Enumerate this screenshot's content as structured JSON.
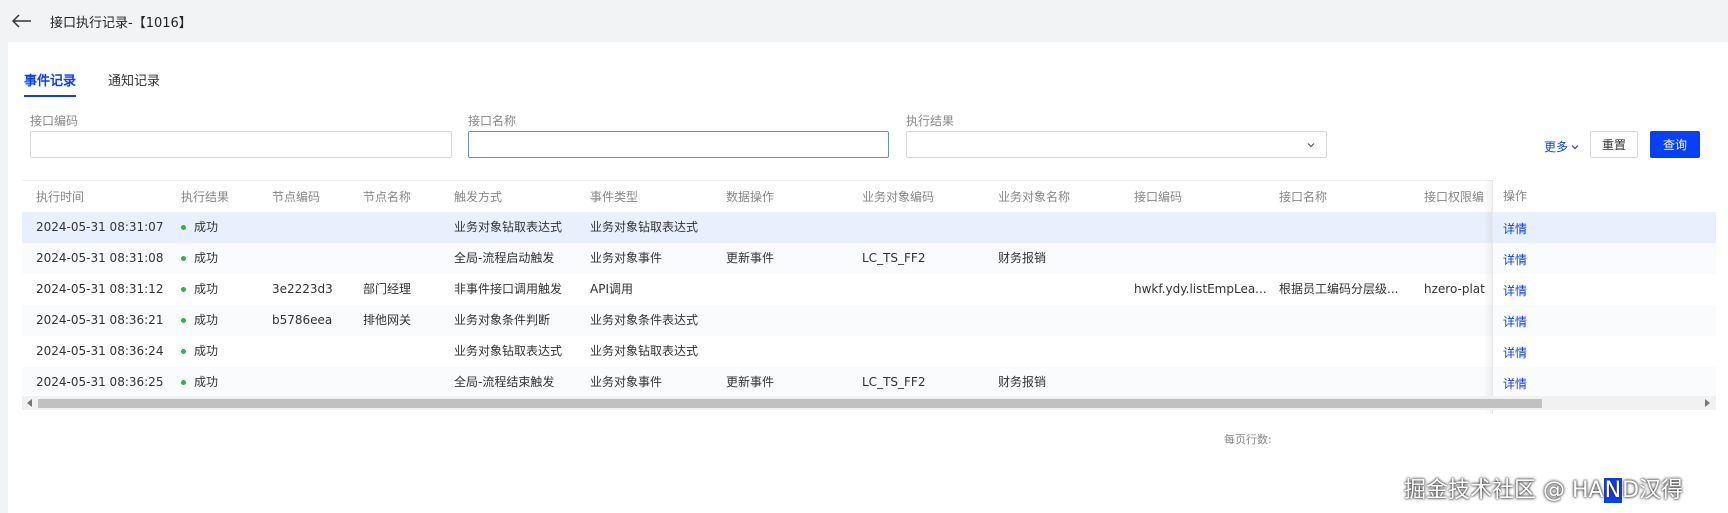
{
  "header": {
    "title": "接口执行记录-【1016】"
  },
  "tabs": [
    {
      "label": "事件记录",
      "active": true
    },
    {
      "label": "通知记录",
      "active": false
    }
  ],
  "filters": {
    "code": {
      "label": "接口编码",
      "value": ""
    },
    "name": {
      "label": "接口名称",
      "value": ""
    },
    "result": {
      "label": "执行结果",
      "value": ""
    }
  },
  "buttons": {
    "more": "更多",
    "reset": "重置",
    "query": "查询"
  },
  "table": {
    "columns": [
      "执行时间",
      "执行结果",
      "节点编码",
      "节点名称",
      "触发方式",
      "事件类型",
      "数据操作",
      "业务对象编码",
      "业务对象名称",
      "接口编码",
      "接口名称",
      "接口权限编"
    ],
    "op_header": "操作",
    "op_label": "详情",
    "rows": [
      [
        "2024-05-31 08:31:07",
        "成功",
        "",
        "",
        "业务对象钻取表达式",
        "业务对象钻取表达式",
        "",
        "",
        "",
        "",
        "",
        ""
      ],
      [
        "2024-05-31 08:31:08",
        "成功",
        "",
        "",
        "全局-流程启动触发",
        "业务对象事件",
        "更新事件",
        "LC_TS_FF2",
        "财务报销",
        "",
        "",
        ""
      ],
      [
        "2024-05-31 08:31:12",
        "成功",
        "3e2223d3",
        "部门经理",
        "非事件接口调用触发",
        "API调用",
        "",
        "",
        "",
        "hwkf.ydy.listEmpLea...",
        "根据员工编码分层级...",
        "hzero-plat"
      ],
      [
        "2024-05-31 08:36:21",
        "成功",
        "b5786eea",
        "排他网关",
        "业务对象条件判断",
        "业务对象条件表达式",
        "",
        "",
        "",
        "",
        "",
        ""
      ],
      [
        "2024-05-31 08:36:24",
        "成功",
        "",
        "",
        "业务对象钻取表达式",
        "业务对象钻取表达式",
        "",
        "",
        "",
        "",
        "",
        ""
      ],
      [
        "2024-05-31 08:36:25",
        "成功",
        "",
        "",
        "全局-流程结束触发",
        "业务对象事件",
        "更新事件",
        "LC_TS_FF2",
        "财务报销",
        "",
        "",
        ""
      ]
    ]
  },
  "pager": {
    "label": "每页行数:"
  },
  "watermark": {
    "text_a": "掘金技术社区 @ HA",
    "text_b": "N",
    "text_c": "D汉得"
  },
  "colors": {
    "accent": "#0840f8",
    "success": "#2fb34a",
    "highlight_row": "#e8f0fd"
  }
}
